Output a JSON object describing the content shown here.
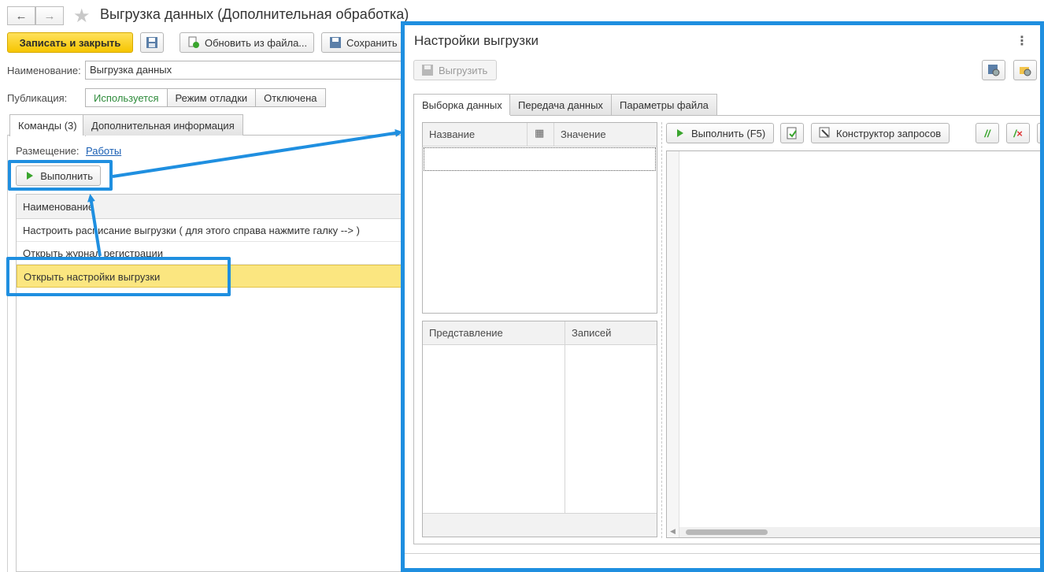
{
  "form": {
    "title": "Выгрузка данных (Дополнительная обработка)",
    "toolbar": {
      "save_close": "Записать и закрыть",
      "update_from_file": "Обновить из файла...",
      "save_to": "Сохранить в"
    },
    "name_label": "Наименование:",
    "name_value": "Выгрузка данных",
    "publication_label": "Публикация:",
    "publication_options": [
      "Используется",
      "Режим отладки",
      "Отключена"
    ],
    "tabs": [
      "Команды (3)",
      "Дополнительная информация"
    ],
    "placement_label": "Размещение:",
    "placement_link": "Работы",
    "run_button": "Выполнить",
    "table_header": "Наименование",
    "rows": [
      "Настроить расписание выгрузки ( для этого справа нажмите галку --> )",
      "Открыть журнал регистрации",
      "Открыть настройки выгрузки"
    ]
  },
  "dialog": {
    "title": "Настройки выгрузки",
    "export_button": "Выгрузить",
    "tabs": [
      "Выборка данных",
      "Передача данных",
      "Параметры файла"
    ],
    "params_grid": {
      "col_name": "Название",
      "col_value": "Значение"
    },
    "results_grid": {
      "col_view": "Представление",
      "col_records": "Записей"
    },
    "run_button": "Выполнить (F5)",
    "query_builder_button": "Конструктор запросов"
  },
  "colors": {
    "highlight": "#1f8fe0",
    "selected_row": "#fbe680",
    "primary_button": "#f6c500"
  }
}
